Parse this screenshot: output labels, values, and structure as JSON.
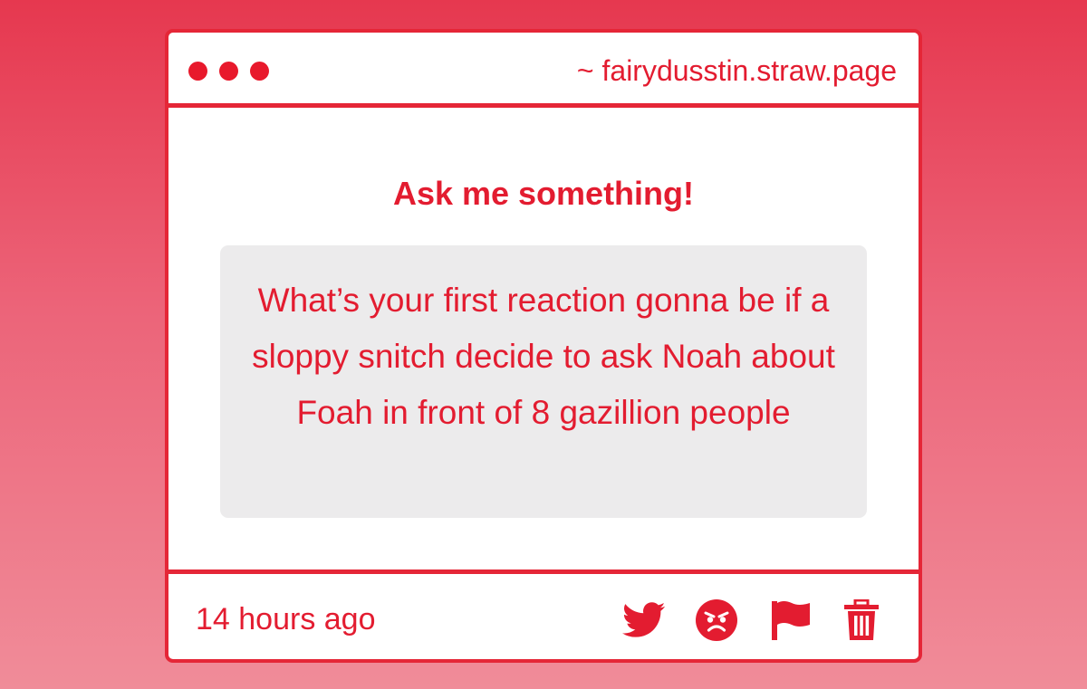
{
  "window": {
    "url": "~ fairydusstin.straw.page",
    "controls": [
      "dot-icon",
      "dot-icon",
      "dot-icon"
    ]
  },
  "prompt": {
    "heading": "Ask me something!"
  },
  "question": {
    "text": "What’s your first reaction gonna be if a sloppy snitch decide to ask Noah about Foah in front of 8 gazillion people"
  },
  "footer": {
    "timestamp": "14 hours ago",
    "actions": [
      {
        "icon": "twitter-icon"
      },
      {
        "icon": "angry-face-icon"
      },
      {
        "icon": "flag-icon"
      },
      {
        "icon": "trash-icon"
      }
    ]
  },
  "colors": {
    "accent": "#e31c30",
    "border": "#e52637",
    "question_background": "#ecebec",
    "card_background": "#ffffff",
    "page_gradient_top": "#e6384f",
    "page_gradient_bottom": "#f08c99"
  }
}
